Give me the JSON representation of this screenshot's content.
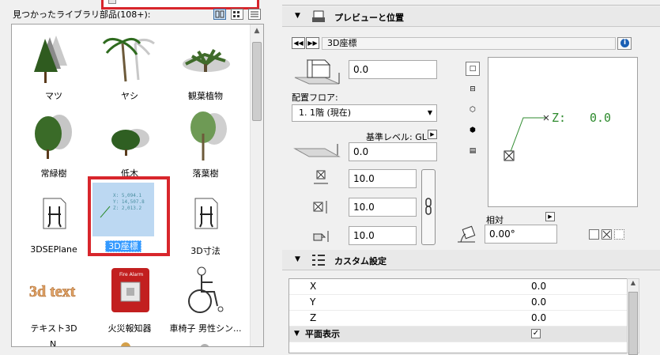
{
  "library": {
    "found_label": "見つかったライブラリ部品(108+):",
    "items": [
      {
        "label": "マツ",
        "icon": "pine-tree-icon"
      },
      {
        "label": "ヤシ",
        "icon": "palm-tree-icon"
      },
      {
        "label": "観葉植物",
        "icon": "houseplant-icon"
      },
      {
        "label": "常緑樹",
        "icon": "evergreen-tree-icon"
      },
      {
        "label": "低木",
        "icon": "shrub-icon"
      },
      {
        "label": "落葉樹",
        "icon": "deciduous-tree-icon"
      },
      {
        "label": "3DSEPlane",
        "icon": "chair-doc-icon"
      },
      {
        "label": "3D座標",
        "icon": "coordinate-icon"
      },
      {
        "label": "3D寸法",
        "icon": "chair-doc-icon"
      },
      {
        "label": "テキスト3D",
        "icon": "text3d-icon"
      },
      {
        "label": "火災報知器",
        "icon": "fire-alarm-icon"
      },
      {
        "label": "車椅子 男性シン...",
        "icon": "wheelchair-icon"
      }
    ],
    "thumb_3d_coord_lines": [
      "X: 5,094.1",
      "Y: 14,507.8",
      "Z: 2,013.2"
    ],
    "text3d_art": "3d text",
    "fire_alarm_caption": "Fire Alarm",
    "next_row_label": "N"
  },
  "preview": {
    "section_title": "プレビューと位置",
    "object_name": "3D座標",
    "height_value": "0.0",
    "floor_label": "配置フロア:",
    "floor_value": "1. 1階 (現在)",
    "ref_level_label": "基準レベル: GL",
    "offset_value": "0.0",
    "size_x": "10.0",
    "size_y": "10.0",
    "size_z": "10.0",
    "canvas_label_z": "Z:",
    "canvas_value_z": "0.0",
    "relative_label": "相対",
    "angle_value": "0.00°"
  },
  "custom": {
    "section_title": "カスタム設定",
    "rows": [
      {
        "name": "X",
        "value": "0.0"
      },
      {
        "name": "Y",
        "value": "0.0"
      },
      {
        "name": "Z",
        "value": "0.0"
      }
    ],
    "group_label": "平面表示",
    "group_checked": true
  },
  "colors": {
    "highlight_red": "#d8262c",
    "selection_blue": "#3399ff",
    "canvas_green": "#2e8b2e"
  }
}
